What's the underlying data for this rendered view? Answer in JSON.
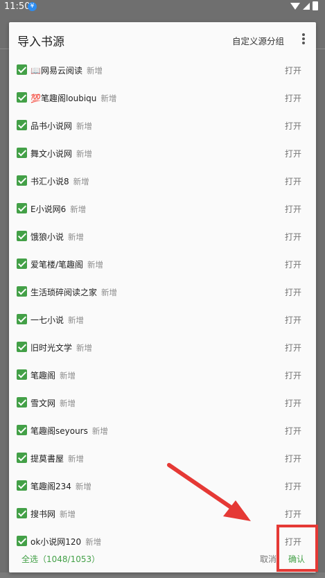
{
  "status_bar": {
    "time": "11:50",
    "notification_badge": "¥"
  },
  "dialog": {
    "title": "导入书源",
    "custom_group_label": "自定义源分组",
    "items": [
      {
        "name": "📖网易云阅读",
        "tag": "新增",
        "action": "打开"
      },
      {
        "name": "💯笔趣阁loubiqu",
        "tag": "新增",
        "action": "打开"
      },
      {
        "name": "品书小说网",
        "tag": "新增",
        "action": "打开"
      },
      {
        "name": "舞文小说网",
        "tag": "新增",
        "action": "打开"
      },
      {
        "name": "书汇小说8",
        "tag": "新增",
        "action": "打开"
      },
      {
        "name": "E小说网6",
        "tag": "新增",
        "action": "打开"
      },
      {
        "name": "饿狼小说",
        "tag": "新增",
        "action": "打开"
      },
      {
        "name": "爱笔楼/笔趣阁",
        "tag": "新增",
        "action": "打开"
      },
      {
        "name": "生活琐碎阅读之家",
        "tag": "新增",
        "action": "打开"
      },
      {
        "name": "一七小说",
        "tag": "新增",
        "action": "打开"
      },
      {
        "name": "旧时光文学",
        "tag": "新增",
        "action": "打开"
      },
      {
        "name": "笔趣阁",
        "tag": "新增",
        "action": "打开"
      },
      {
        "name": "雪文网",
        "tag": "新增",
        "action": "打开"
      },
      {
        "name": "笔趣阁seyours",
        "tag": "新增",
        "action": "打开"
      },
      {
        "name": "提莫書屋",
        "tag": "新增",
        "action": "打开"
      },
      {
        "name": "笔趣阁234",
        "tag": "新增",
        "action": "打开"
      },
      {
        "name": "搜书网",
        "tag": "新增",
        "action": "打开"
      },
      {
        "name": "ok小说网120",
        "tag": "新增",
        "action": "打开"
      }
    ],
    "footer": {
      "select_all": "全选（1048/1053）",
      "cancel": "取消",
      "confirm": "确认"
    }
  },
  "colors": {
    "accent": "#43a047",
    "annotation": "#e53935"
  }
}
